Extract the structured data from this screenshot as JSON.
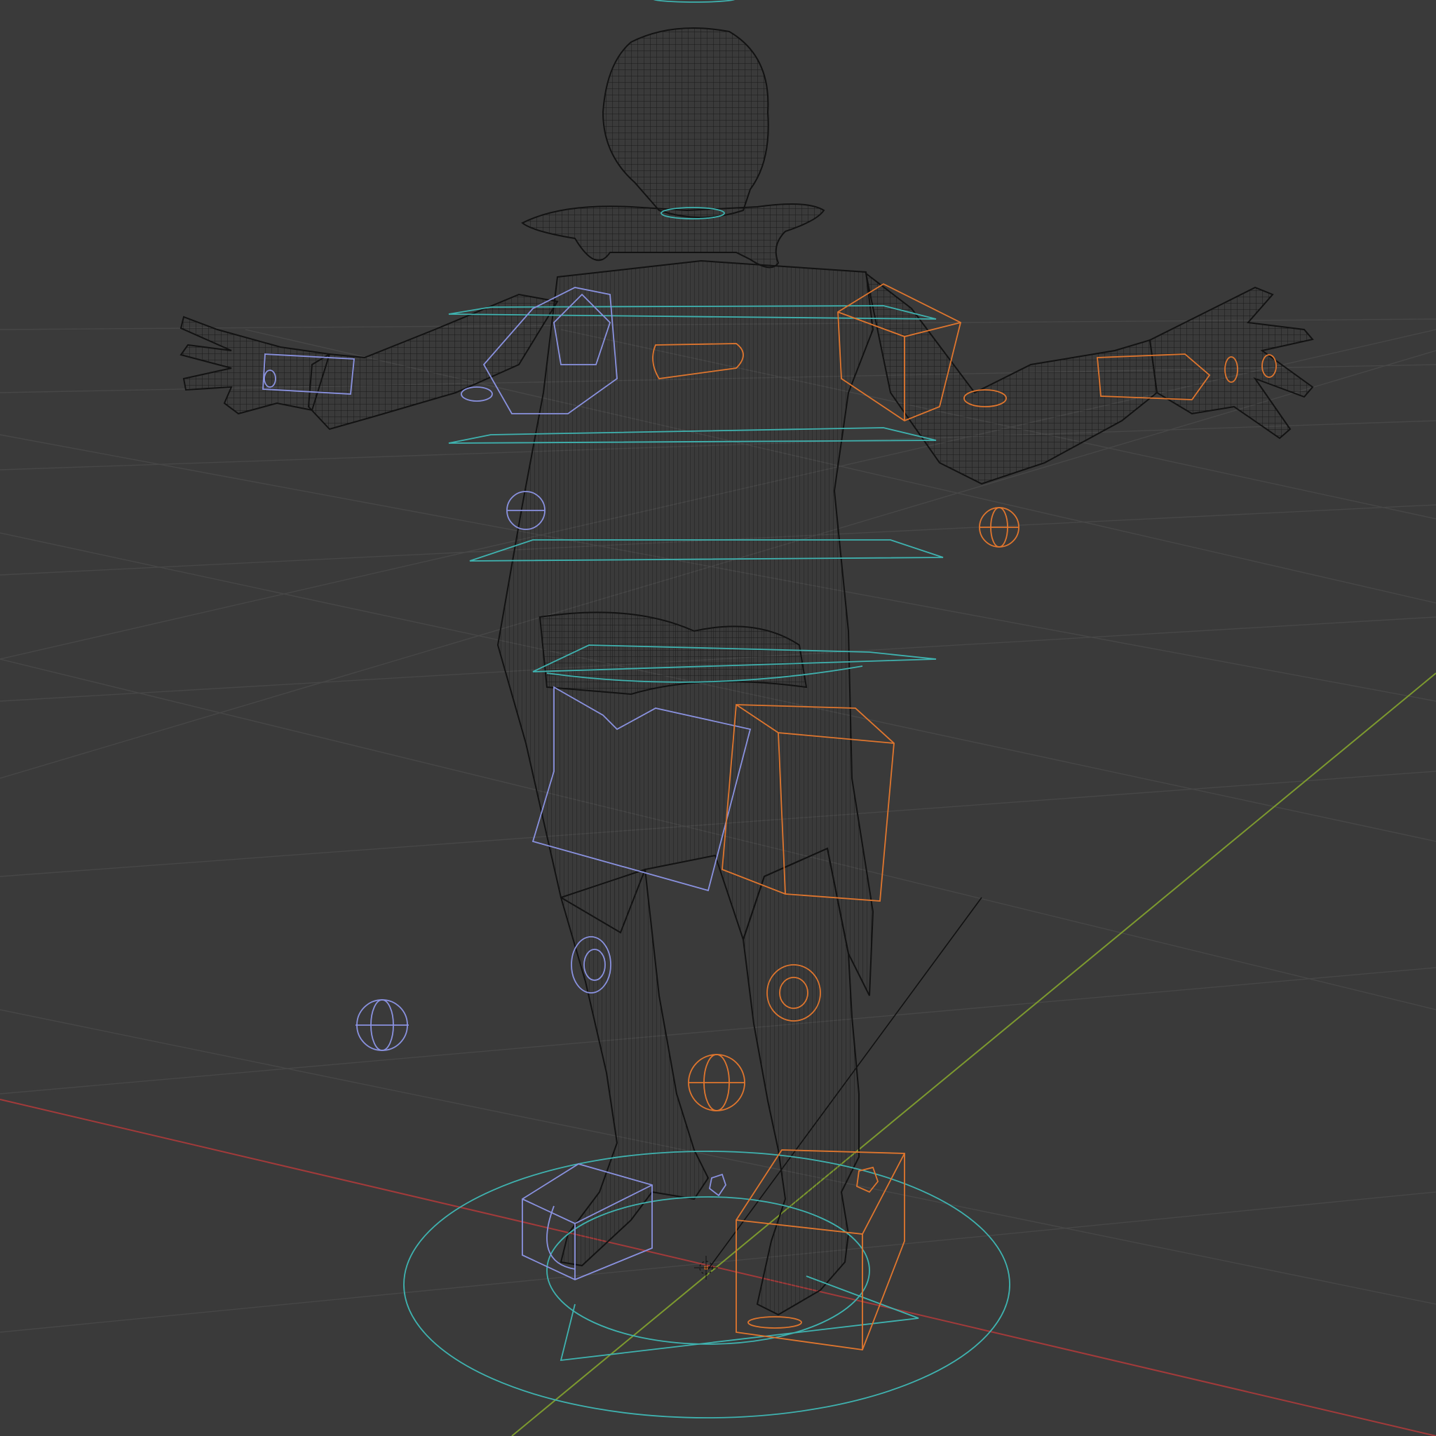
{
  "viewport": {
    "mode": "wireframe",
    "background": "#3a3a3a",
    "grid_color": "#4a4a4a",
    "x_axis_color": "#a33a3a",
    "y_axis_color": "#7d9a2f",
    "mesh_color": "#151515",
    "left_controls_color": "#8a92e0",
    "right_controls_color": "#e0762e",
    "center_controls_color": "#3fb3b0",
    "origin_icon": "3d-cursor-icon",
    "object": "character-wireframe-mesh",
    "rig": "armature-control-shapes"
  }
}
